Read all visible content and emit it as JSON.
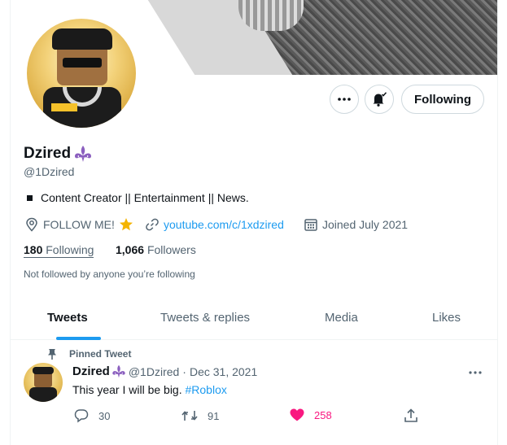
{
  "profile": {
    "display_name": "Dzired",
    "handle": "@1Dzired",
    "bio": "Content Creator || Entertainment || News.",
    "location": "FOLLOW ME!",
    "url": "youtube.com/c/1xdzired",
    "joined": "Joined July 2021",
    "following_count": "180",
    "following_label": "Following",
    "followers_count": "1,066",
    "followers_label": "Followers",
    "not_followed_note": "Not followed by anyone you’re following"
  },
  "actions": {
    "follow_button_label": "Following"
  },
  "tabs": [
    {
      "label": "Tweets",
      "active": true
    },
    {
      "label": "Tweets & replies",
      "active": false
    },
    {
      "label": "Media",
      "active": false
    },
    {
      "label": "Likes",
      "active": false
    }
  ],
  "pinned_tweet": {
    "pinned_label": "Pinned Tweet",
    "author_name": "Dzired",
    "author_handle": "@1Dzired",
    "separator": "·",
    "date": "Dec 31, 2021",
    "text": "This year I will be big.",
    "hashtag": "#Roblox",
    "reply_count": "30",
    "retweet_count": "91",
    "like_count": "258"
  },
  "icons": {
    "more": "more-horizontal-icon",
    "notify": "bell-check-icon",
    "location": "location-pin-icon",
    "link": "link-icon",
    "calendar": "calendar-icon",
    "pin": "pin-icon",
    "reply": "reply-icon",
    "retweet": "retweet-icon",
    "like": "heart-filled-icon",
    "share": "share-icon",
    "verified_badge": "fleur-de-lis-icon"
  },
  "colors": {
    "accent": "#1d9bf0",
    "like": "#f91880",
    "badge": "#8b5fbf",
    "text_secondary": "#536471"
  }
}
